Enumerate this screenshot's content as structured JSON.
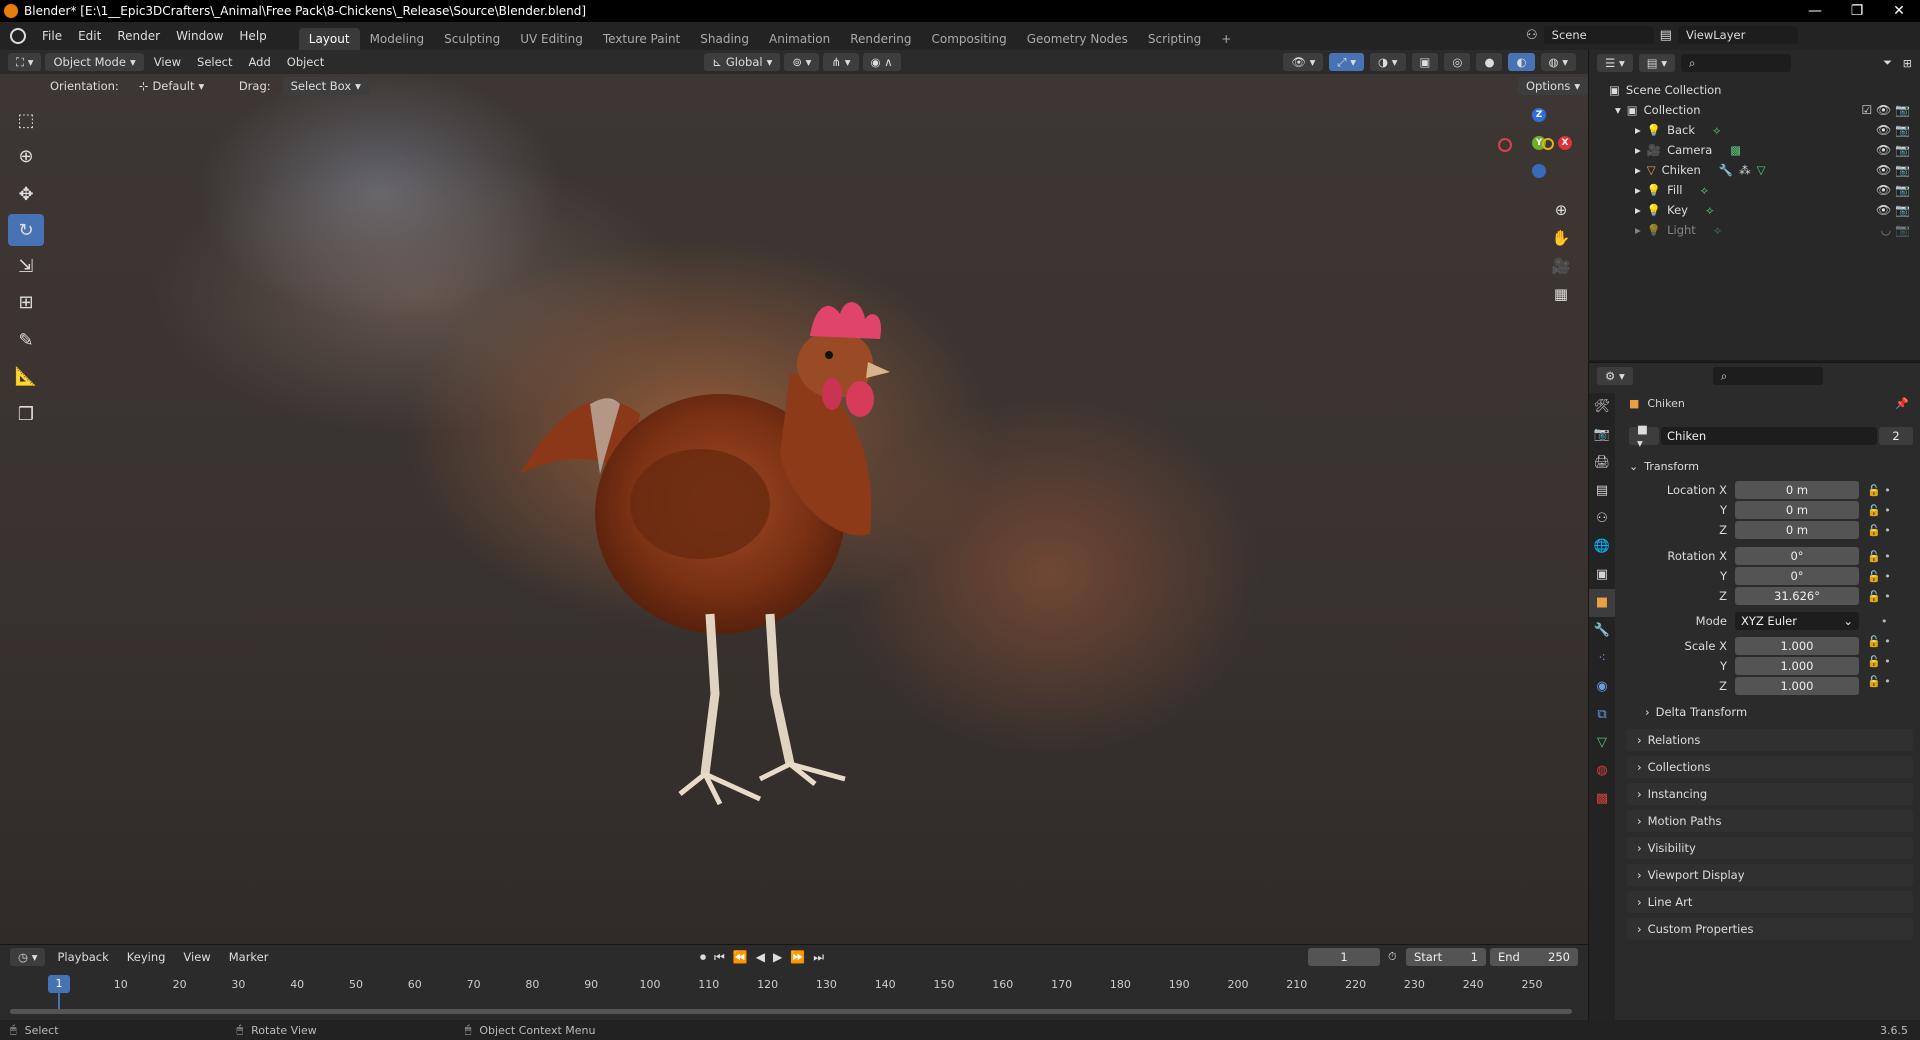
{
  "window": {
    "title": "Blender* [E:\\1__Epic3DCrafters\\_Animal\\Free Pack\\8-Chickens\\_Release\\Source\\Blender.blend]"
  },
  "menu": [
    "File",
    "Edit",
    "Render",
    "Window",
    "Help"
  ],
  "workspaces": [
    "Layout",
    "Modeling",
    "Sculpting",
    "UV Editing",
    "Texture Paint",
    "Shading",
    "Animation",
    "Rendering",
    "Compositing",
    "Geometry Nodes",
    "Scripting"
  ],
  "active_workspace": "Layout",
  "scene": {
    "name": "Scene",
    "view_layer": "ViewLayer"
  },
  "viewport_header": {
    "mode": "Object Mode",
    "menus": [
      "View",
      "Select",
      "Add",
      "Object"
    ],
    "transform": "Global",
    "options": "Options"
  },
  "tool_options": {
    "orientation_label": "Orientation:",
    "orientation": "Default",
    "drag_label": "Drag:",
    "drag": "Select Box"
  },
  "gizmo": {
    "z": "Z",
    "y": "Y",
    "x": "X"
  },
  "outliner": {
    "root": "Scene Collection",
    "collection": "Collection",
    "items": [
      "Back",
      "Camera",
      "Chiken",
      "Fill",
      "Key",
      "Light"
    ]
  },
  "properties": {
    "object_name": "Chiken",
    "data_name": "Chiken",
    "users": "2",
    "transform": {
      "header": "Transform",
      "location_label": "Location X",
      "location": [
        "0 m",
        "0 m",
        "0 m"
      ],
      "rotation_label": "Rotation X",
      "rotation": [
        "0°",
        "0°",
        "31.626°"
      ],
      "mode_label": "Mode",
      "mode": "XYZ Euler",
      "scale_label": "Scale X",
      "scale": [
        "1.000",
        "1.000",
        "1.000"
      ],
      "axis_y": "Y",
      "axis_z": "Z"
    },
    "delta": "Delta Transform",
    "panels": [
      "Relations",
      "Collections",
      "Instancing",
      "Motion Paths",
      "Visibility",
      "Viewport Display",
      "Line Art",
      "Custom Properties"
    ]
  },
  "timeline": {
    "menus": [
      "Playback",
      "Keying",
      "View",
      "Marker"
    ],
    "current_frame": "1",
    "start_label": "Start",
    "start": "1",
    "end_label": "End",
    "end": "250",
    "ticks": [
      "10",
      "20",
      "30",
      "40",
      "50",
      "60",
      "70",
      "80",
      "90",
      "100",
      "110",
      "120",
      "130",
      "140",
      "150",
      "160",
      "170",
      "180",
      "190",
      "200",
      "210",
      "220",
      "230",
      "240",
      "250"
    ],
    "marker": "1"
  },
  "status": {
    "select": "Select",
    "rotate": "Rotate View",
    "context": "Object Context Menu",
    "version": "3.6.5"
  }
}
